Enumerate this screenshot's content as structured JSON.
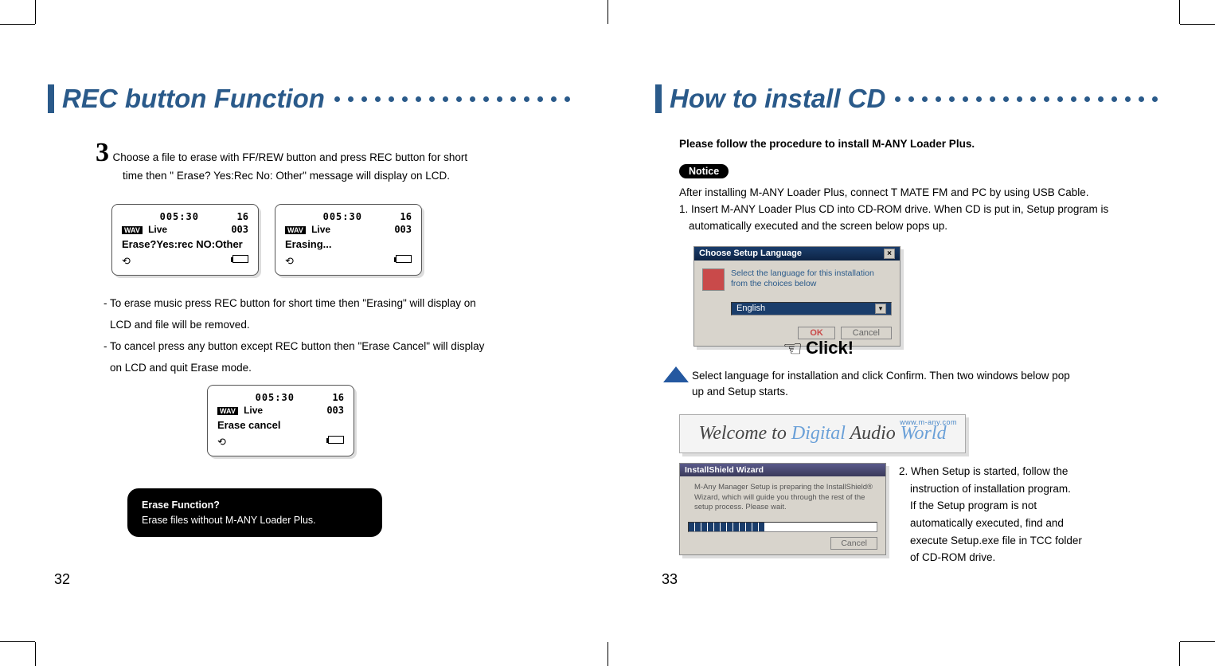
{
  "left": {
    "title": "REC button Function",
    "step_num": "3",
    "step_line1": "Choose a file to erase with FF/REW button and press REC button for short",
    "step_line2": "time then \" Erase? Yes:Rec No: Other\" message will display on LCD.",
    "lcd": {
      "time": "005:30",
      "count_top": "16",
      "fmt": "WAV",
      "track": "Live",
      "count_r": "003",
      "msg1": "Erase?Yes:rec NO:Other",
      "msg2": "Erasing...",
      "msg3": "Erase cancel"
    },
    "para1a": "- To erase music press REC button for short time then \"Erasing\" will display on",
    "para1b": "LCD and file will be removed.",
    "para2a": "- To cancel press any button except REC button then \"Erase Cancel\" will display",
    "para2b": "on LCD and quit Erase mode.",
    "note_title": "Erase Function?",
    "note_body": "Erase files without M-ANY Loader Plus.",
    "pagenum": "32"
  },
  "right": {
    "title": "How to install CD",
    "intro": "Please follow the procedure to install M-ANY Loader Plus.",
    "notice_label": "Notice",
    "after_notice": "After installing M-ANY Loader Plus, connect T MATE FM and PC by using USB Cable.",
    "step1a": "1. Insert M-ANY Loader Plus CD into CD-ROM drive. When CD is put in, Setup program is",
    "step1b": "automatically executed and the screen below pops up.",
    "dialog1": {
      "title": "Choose Setup Language",
      "close": "×",
      "msg": "Select the language for this installation from the choices below",
      "lang": "English",
      "ok": "OK",
      "cancel": "Cancel"
    },
    "click_label": "Click!",
    "after_click_a": "Select language for installation and click Confirm. Then two windows below pop",
    "after_click_b": "up and Setup starts.",
    "welcome_url": "www.m-any.com",
    "welcome_a": "Welcome to ",
    "welcome_b": "Digital ",
    "welcome_c": "Audio ",
    "welcome_d": "World",
    "wizard": {
      "title": "InstallShield Wizard",
      "msg": "M-Any Manager Setup is preparing the InstallShield® Wizard, which will guide you through the rest of the setup process. Please wait.",
      "cancel": "Cancel"
    },
    "step2_a": "2. When Setup is started, follow the",
    "step2_b": "instruction of installation program.",
    "step2_c": "If the Setup program is not",
    "step2_d": "automatically executed, find and",
    "step2_e": "execute Setup.exe file in TCC folder",
    "step2_f": "of CD-ROM drive.",
    "pagenum": "33"
  }
}
